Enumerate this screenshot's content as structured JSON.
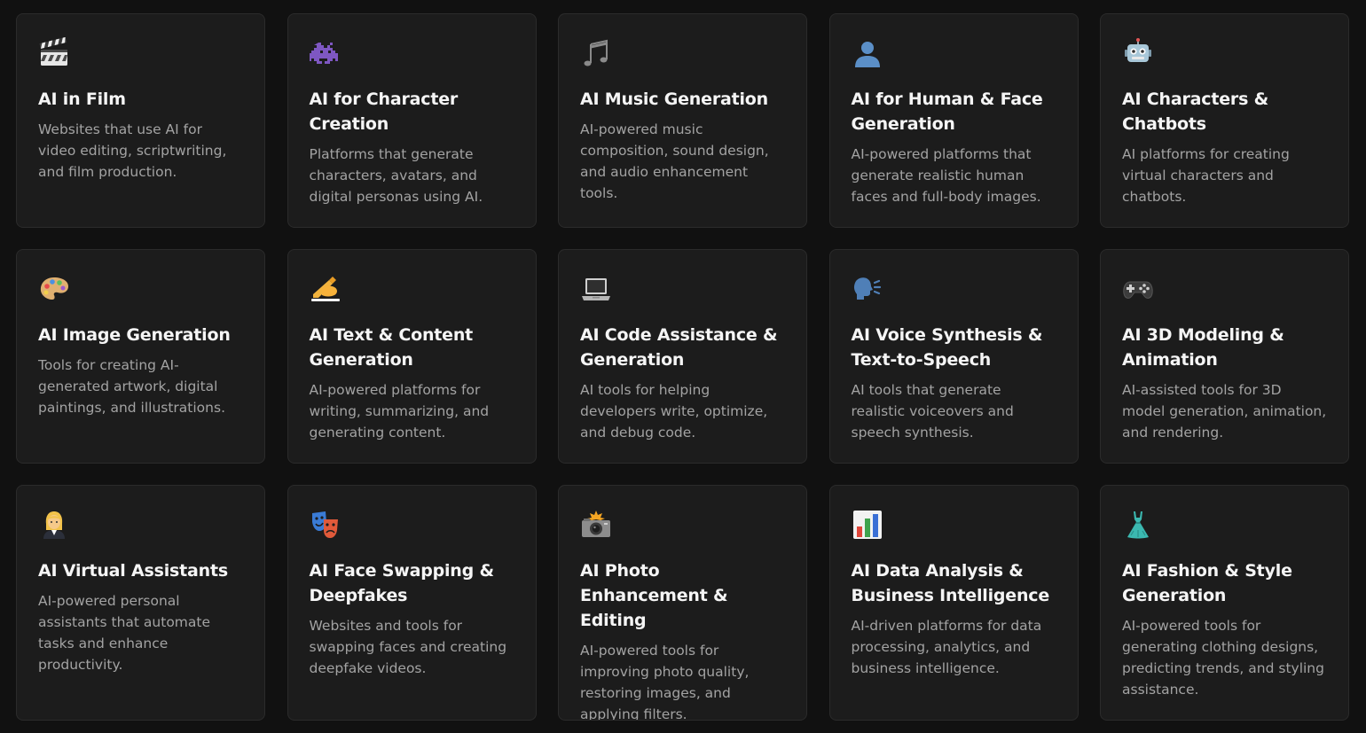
{
  "categories": [
    {
      "title": "AI in Film",
      "description": "Websites that use AI for video editing, scriptwriting, and film production.",
      "icon": "clapperboard-icon"
    },
    {
      "title": "AI for Character Creation",
      "description": "Platforms that generate characters, avatars, and digital personas using AI.",
      "icon": "alien-monster-icon"
    },
    {
      "title": "AI Music Generation",
      "description": "AI-powered music composition, sound design, and audio enhancement tools.",
      "icon": "musical-notes-icon"
    },
    {
      "title": "AI for Human & Face Generation",
      "description": "AI-powered platforms that generate realistic human faces and full-body images.",
      "icon": "person-silhouette-icon"
    },
    {
      "title": "AI Characters & Chatbots",
      "description": "AI platforms for creating virtual characters and chatbots.",
      "icon": "robot-icon"
    },
    {
      "title": "AI Image Generation",
      "description": "Tools for creating AI-generated artwork, digital paintings, and illustrations.",
      "icon": "artist-palette-icon"
    },
    {
      "title": "AI Text & Content Generation",
      "description": "AI-powered platforms for writing, summarizing, and generating content.",
      "icon": "writing-hand-icon"
    },
    {
      "title": "AI Code Assistance & Generation",
      "description": "AI tools for helping developers write, optimize, and debug code.",
      "icon": "laptop-icon"
    },
    {
      "title": "AI Voice Synthesis & Text-to-Speech",
      "description": "AI tools that generate realistic voiceovers and speech synthesis.",
      "icon": "speaking-head-icon"
    },
    {
      "title": "AI 3D Modeling & Animation",
      "description": "AI-assisted tools for 3D model generation, animation, and rendering.",
      "icon": "game-controller-icon"
    },
    {
      "title": "AI Virtual Assistants",
      "description": "AI-powered personal assistants that automate tasks and enhance productivity.",
      "icon": "office-worker-icon"
    },
    {
      "title": "AI Face Swapping & Deepfakes",
      "description": "Websites and tools for swapping faces and creating deepfake videos.",
      "icon": "theater-masks-icon"
    },
    {
      "title": "AI Photo Enhancement & Editing",
      "description": "AI-powered tools for improving photo quality, restoring images, and applying filters.",
      "icon": "camera-flash-icon"
    },
    {
      "title": "AI Data Analysis & Business Intelligence",
      "description": "AI-driven platforms for data processing, analytics, and business intelligence.",
      "icon": "bar-chart-icon"
    },
    {
      "title": "AI Fashion & Style Generation",
      "description": "AI-powered tools for generating clothing designs, predicting trends, and styling assistance.",
      "icon": "dress-icon"
    }
  ],
  "colors": {
    "background": "#111111",
    "card": "#1c1c1c",
    "card_border": "#2b2b2b",
    "title": "#f5f5f5",
    "description": "#a3a3a3"
  }
}
